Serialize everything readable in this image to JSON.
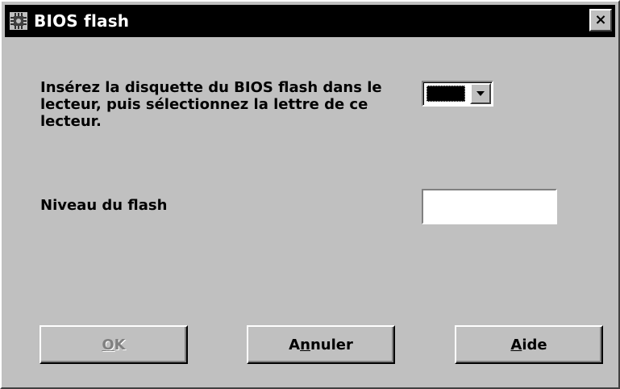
{
  "window": {
    "title": "BIOS flash",
    "close_label": "×"
  },
  "content": {
    "instruction": "Insérez la disquette du BIOS flash dans le lecteur, puis sélectionnez la lettre de ce lecteur.",
    "drive_value": "",
    "level_label": "Niveau du flash",
    "level_value": ""
  },
  "buttons": {
    "ok": {
      "label": "OK",
      "mnemonic": "O",
      "rest": "K",
      "enabled": false
    },
    "cancel": {
      "label": "Annuler",
      "pre": "A",
      "mnemonic": "n",
      "rest": "nuler",
      "enabled": true
    },
    "help": {
      "label": "Aide",
      "mnemonic": "A",
      "rest": "ide",
      "enabled": true
    }
  },
  "icons": {
    "title": "bios-chip-icon",
    "dropdown": "chevron-down-icon",
    "close": "close-icon"
  },
  "colors": {
    "face": "#c0c0c0",
    "titlebar": "#000000",
    "disabled_text": "#808080"
  }
}
